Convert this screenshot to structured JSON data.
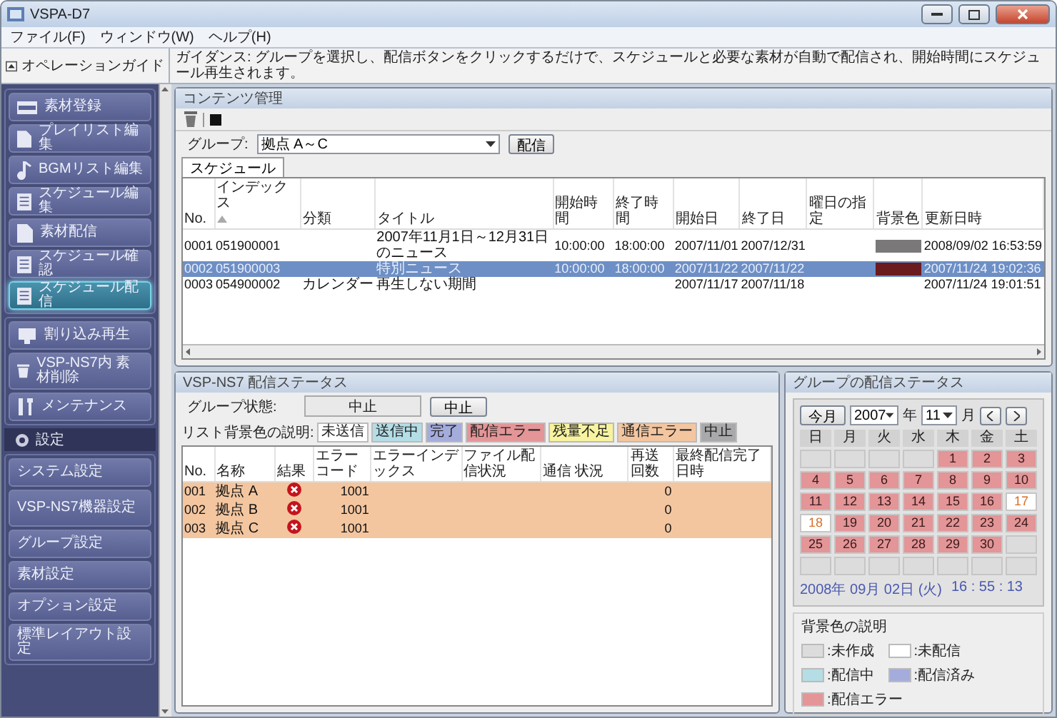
{
  "window": {
    "title": "VSPA-D7"
  },
  "menu": [
    "ファイル(F)",
    "ウィンドウ(W)",
    "ヘルプ(H)"
  ],
  "guide": {
    "label": "オペレーションガイド",
    "text": "ガイダンス: グループを選択し、配信ボタンをクリックするだけで、スケジュールと必要な素材が自動で配信され、開始時間にスケジュール再生されます。"
  },
  "sidebar": {
    "groups": [
      {
        "items": [
          {
            "label": "素材登録",
            "kind": "film",
            "selected": false
          },
          {
            "label": "プレイリスト編集",
            "kind": "document",
            "selected": false
          },
          {
            "label": "BGMリスト編集",
            "kind": "music",
            "selected": false
          },
          {
            "label": "スケジュール編集",
            "kind": "list",
            "selected": false
          },
          {
            "label": "素材配信",
            "kind": "document",
            "selected": false
          },
          {
            "label": "スケジュール確認",
            "kind": "list",
            "selected": false
          },
          {
            "label": "スケジュール配信",
            "kind": "list",
            "selected": true
          }
        ]
      },
      {
        "items": [
          {
            "label": "割り込み再生",
            "kind": "screen",
            "selected": false
          },
          {
            "label": "VSP-NS7内 素材削除",
            "kind": "trash",
            "selected": false
          },
          {
            "label": "メンテナンス",
            "kind": "tools",
            "selected": false
          }
        ]
      }
    ],
    "settings": {
      "label": "設定",
      "items": [
        {
          "label": "システム設定",
          "selected": false
        },
        {
          "label": "VSP-NS7機器設定",
          "selected": false
        },
        {
          "label": "グループ設定",
          "selected": false
        },
        {
          "label": "素材設定",
          "selected": false
        },
        {
          "label": "オプション設定",
          "selected": false
        },
        {
          "label": "標準レイアウト設定",
          "selected": false
        }
      ]
    }
  },
  "content": {
    "title": "コンテンツ管理",
    "group_label": "グループ:",
    "group_value": "拠点 A～C",
    "send_button": "配信",
    "tabs": [
      {
        "label": "スケジュール",
        "selected": true
      }
    ],
    "columns": [
      {
        "label": "No.",
        "sorted": false
      },
      {
        "label": "インデックス",
        "sorted": true
      },
      {
        "label": "分類",
        "sorted": false
      },
      {
        "label": "タイトル",
        "sorted": false
      },
      {
        "label": "開始時間",
        "sorted": false
      },
      {
        "label": "終了時間",
        "sorted": false
      },
      {
        "label": "開始日",
        "sorted": false
      },
      {
        "label": "終了日",
        "sorted": false
      },
      {
        "label": "曜日の指定",
        "sorted": false
      },
      {
        "label": "背景色",
        "sorted": false
      },
      {
        "label": "更新日時",
        "sorted": false
      }
    ],
    "rows": [
      {
        "no": "0001",
        "index": "051900001",
        "title": "2007年11月1日～12月31日のニュース",
        "start_time": "10:00:00",
        "end_time": "18:00:00",
        "start_date": "2007/11/01",
        "end_date": "2007/12/31",
        "color": "#7a7878",
        "updated": "2008/09/02 16:53:59",
        "selected": false
      },
      {
        "no": "0002",
        "index": "051900003",
        "title": "特別ニュース",
        "start_time": "10:00:00",
        "end_time": "18:00:00",
        "start_date": "2007/11/22",
        "end_date": "2007/11/22",
        "color": "#6b1a1e",
        "updated": "2007/11/24 19:02:36",
        "selected": true
      },
      {
        "no": "0003",
        "index": "054900002",
        "category": "カレンダー",
        "title": "再生しない期間",
        "start_date": "2007/11/17",
        "end_date": "2007/11/18",
        "updated": "2007/11/24 19:01:51",
        "selected": false
      }
    ]
  },
  "status": {
    "title": "VSP-NS7 配信ステータス",
    "group_state_label": "グループ状態:",
    "group_state": "中止",
    "stop_button": "中止",
    "legend_label": "リスト背景色の説明:",
    "legend": [
      {
        "label": "未送信",
        "color": "#ffffff"
      },
      {
        "label": "送信中",
        "color": "#b4dde6"
      },
      {
        "label": "完了",
        "color": "#a4acdc"
      },
      {
        "label": "配信エラー",
        "color": "#e39597"
      },
      {
        "label": "残量不足",
        "color": "#f7f3a0"
      },
      {
        "label": "通信エラー",
        "color": "#f3c6a0"
      },
      {
        "label": "中止",
        "color": "#a9a9ab"
      }
    ],
    "columns": [
      "No.",
      "名称",
      "結果",
      "エラーコード",
      "エラーインデックス",
      "ファイル配信状況",
      "通信 状況",
      "再送回数",
      "最終配信完了日時"
    ],
    "rows": [
      {
        "no": "001",
        "name": "拠点 A",
        "failed": true,
        "error_code": "1001",
        "retries": "0",
        "color": "#f3c6a0"
      },
      {
        "no": "002",
        "name": "拠点 B",
        "failed": true,
        "error_code": "1001",
        "retries": "0",
        "color": "#f3c6a0"
      },
      {
        "no": "003",
        "name": "拠点 C",
        "failed": true,
        "error_code": "1001",
        "retries": "0",
        "color": "#f3c6a0"
      }
    ]
  },
  "calendar": {
    "title": "グループの配信ステータス",
    "today_button": "今月",
    "year": "2007",
    "year_suffix": "年",
    "month": "11",
    "month_suffix": "月",
    "weekdays": [
      "日",
      "月",
      "火",
      "水",
      "木",
      "金",
      "土"
    ],
    "cells": [
      {
        "color": "#dcdcdc"
      },
      {
        "color": "#dcdcdc"
      },
      {
        "color": "#dcdcdc"
      },
      {
        "color": "#dcdcdc"
      },
      {
        "day": "1",
        "color": "#e39597"
      },
      {
        "day": "2",
        "color": "#e39597"
      },
      {
        "day": "3",
        "color": "#e39597"
      },
      {
        "day": "4",
        "color": "#e39597"
      },
      {
        "day": "5",
        "color": "#e39597"
      },
      {
        "day": "6",
        "color": "#e39597"
      },
      {
        "day": "7",
        "color": "#e39597"
      },
      {
        "day": "8",
        "color": "#e39597"
      },
      {
        "day": "9",
        "color": "#e39597"
      },
      {
        "day": "10",
        "color": "#e39597"
      },
      {
        "day": "11",
        "color": "#e39597"
      },
      {
        "day": "12",
        "color": "#e39597"
      },
      {
        "day": "13",
        "color": "#e39597"
      },
      {
        "day": "14",
        "color": "#e39597"
      },
      {
        "day": "15",
        "color": "#e39597"
      },
      {
        "day": "16",
        "color": "#e39597"
      },
      {
        "day": "17",
        "color": "#ffffff"
      },
      {
        "day": "18",
        "color": "#ffffff"
      },
      {
        "day": "19",
        "color": "#e39597"
      },
      {
        "day": "20",
        "color": "#e39597"
      },
      {
        "day": "21",
        "color": "#e39597"
      },
      {
        "day": "22",
        "color": "#e39597"
      },
      {
        "day": "23",
        "color": "#e39597"
      },
      {
        "day": "24",
        "color": "#e39597"
      },
      {
        "day": "25",
        "color": "#e39597"
      },
      {
        "day": "26",
        "color": "#e39597"
      },
      {
        "day": "27",
        "color": "#e39597"
      },
      {
        "day": "28",
        "color": "#e39597"
      },
      {
        "day": "29",
        "color": "#e39597"
      },
      {
        "day": "30",
        "color": "#e39597"
      },
      {
        "color": "#dcdcdc"
      },
      {
        "color": "#dcdcdc"
      },
      {
        "color": "#dcdcdc"
      },
      {
        "color": "#dcdcdc"
      },
      {
        "color": "#dcdcdc"
      },
      {
        "color": "#dcdcdc"
      },
      {
        "color": "#dcdcdc"
      },
      {
        "color": "#dcdcdc"
      }
    ],
    "date": "2008年 09月 02日 (火)",
    "time": "16 : 55 : 13",
    "legend_title": "背景色の説明",
    "legend": [
      {
        "label": ":未作成",
        "color": "#dcdcdc"
      },
      {
        "label": ":未配信",
        "color": "#ffffff"
      },
      {
        "label": ":配信中",
        "color": "#b4dde6"
      },
      {
        "label": ":配信済み",
        "color": "#a4acdc"
      },
      {
        "label": ":配信エラー",
        "color": "#e39597"
      }
    ]
  }
}
